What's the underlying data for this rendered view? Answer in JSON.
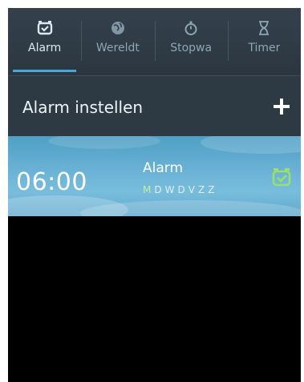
{
  "tabs": [
    {
      "label": "Alarm",
      "icon": "alarm-clock-icon",
      "active": true
    },
    {
      "label": "Wereldt",
      "icon": "globe-icon",
      "active": false
    },
    {
      "label": "Stopwa",
      "icon": "stopwatch-icon",
      "active": false
    },
    {
      "label": "Timer",
      "icon": "hourglass-icon",
      "active": false
    }
  ],
  "header": {
    "title": "Alarm instellen",
    "add_icon": "plus-icon"
  },
  "alarm": {
    "time": "06:00",
    "name": "Alarm",
    "days": [
      "M",
      "D",
      "W",
      "D",
      "V",
      "Z",
      "Z"
    ],
    "toggle_icon": "alarm-clock-icon",
    "enabled": true
  },
  "colors": {
    "accent": "#4aa5d8",
    "toggle_on": "#9be06a"
  }
}
